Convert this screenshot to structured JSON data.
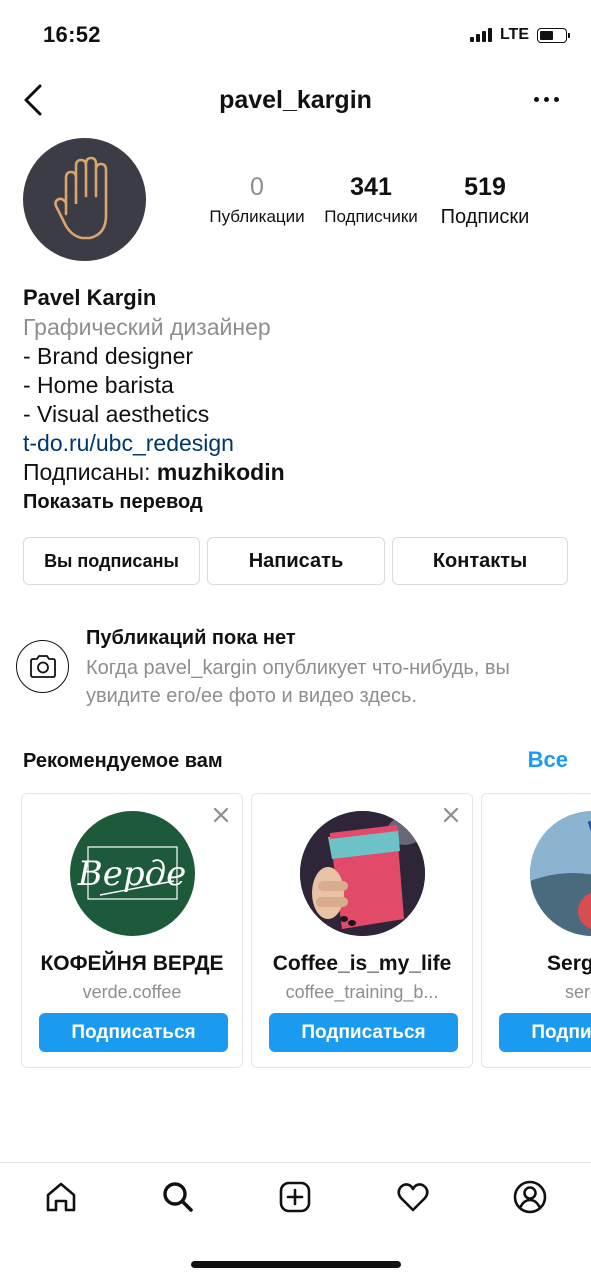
{
  "status_bar": {
    "time": "16:52",
    "network": "LTE"
  },
  "header": {
    "username": "pavel_kargin"
  },
  "stats": [
    {
      "value": "0",
      "label": "Публикации"
    },
    {
      "value": "341",
      "label": "Подписчики"
    },
    {
      "value": "519",
      "label": "Подписки"
    }
  ],
  "bio": {
    "name": "Pavel Kargin",
    "category": "Графический дизайнер",
    "lines": [
      "- Brand designer",
      "- Home barista",
      "- Visual aesthetics"
    ],
    "link": "t-do.ru/ubc_redesign",
    "followed_prefix": "Подписаны: ",
    "followed_by": "muzhikodin",
    "translate": "Показать перевод"
  },
  "actions": {
    "following": "Вы подписаны",
    "message": "Написать",
    "contacts": "Контакты"
  },
  "empty_posts": {
    "title": "Публикаций пока нет",
    "text": "Когда pavel_kargin опубликует что-нибудь, вы увидите его/ее фото и видео здесь."
  },
  "suggestions": {
    "title": "Рекомендуемое вам",
    "see_all": "Все",
    "follow_label": "Подписаться",
    "cards": [
      {
        "name": "КОФЕЙНЯ ВЕРДЕ",
        "username": "verde.coffee",
        "logo_text": "Верде"
      },
      {
        "name": "Coffee_is_my_life",
        "username": "coffee_training_b..."
      },
      {
        "name": "Sergey S",
        "username": "sergey"
      }
    ]
  },
  "colors": {
    "accent": "#1a9bf0",
    "link": "#00376b",
    "muted": "#8e8e8e",
    "avatar_bg": "#3b3c45",
    "hand_icon": "#d9a56f",
    "verde_green": "#1c5a3a"
  },
  "tabbar": [
    "home-icon",
    "search-icon",
    "new-post-icon",
    "activity-heart-icon",
    "profile-icon"
  ]
}
